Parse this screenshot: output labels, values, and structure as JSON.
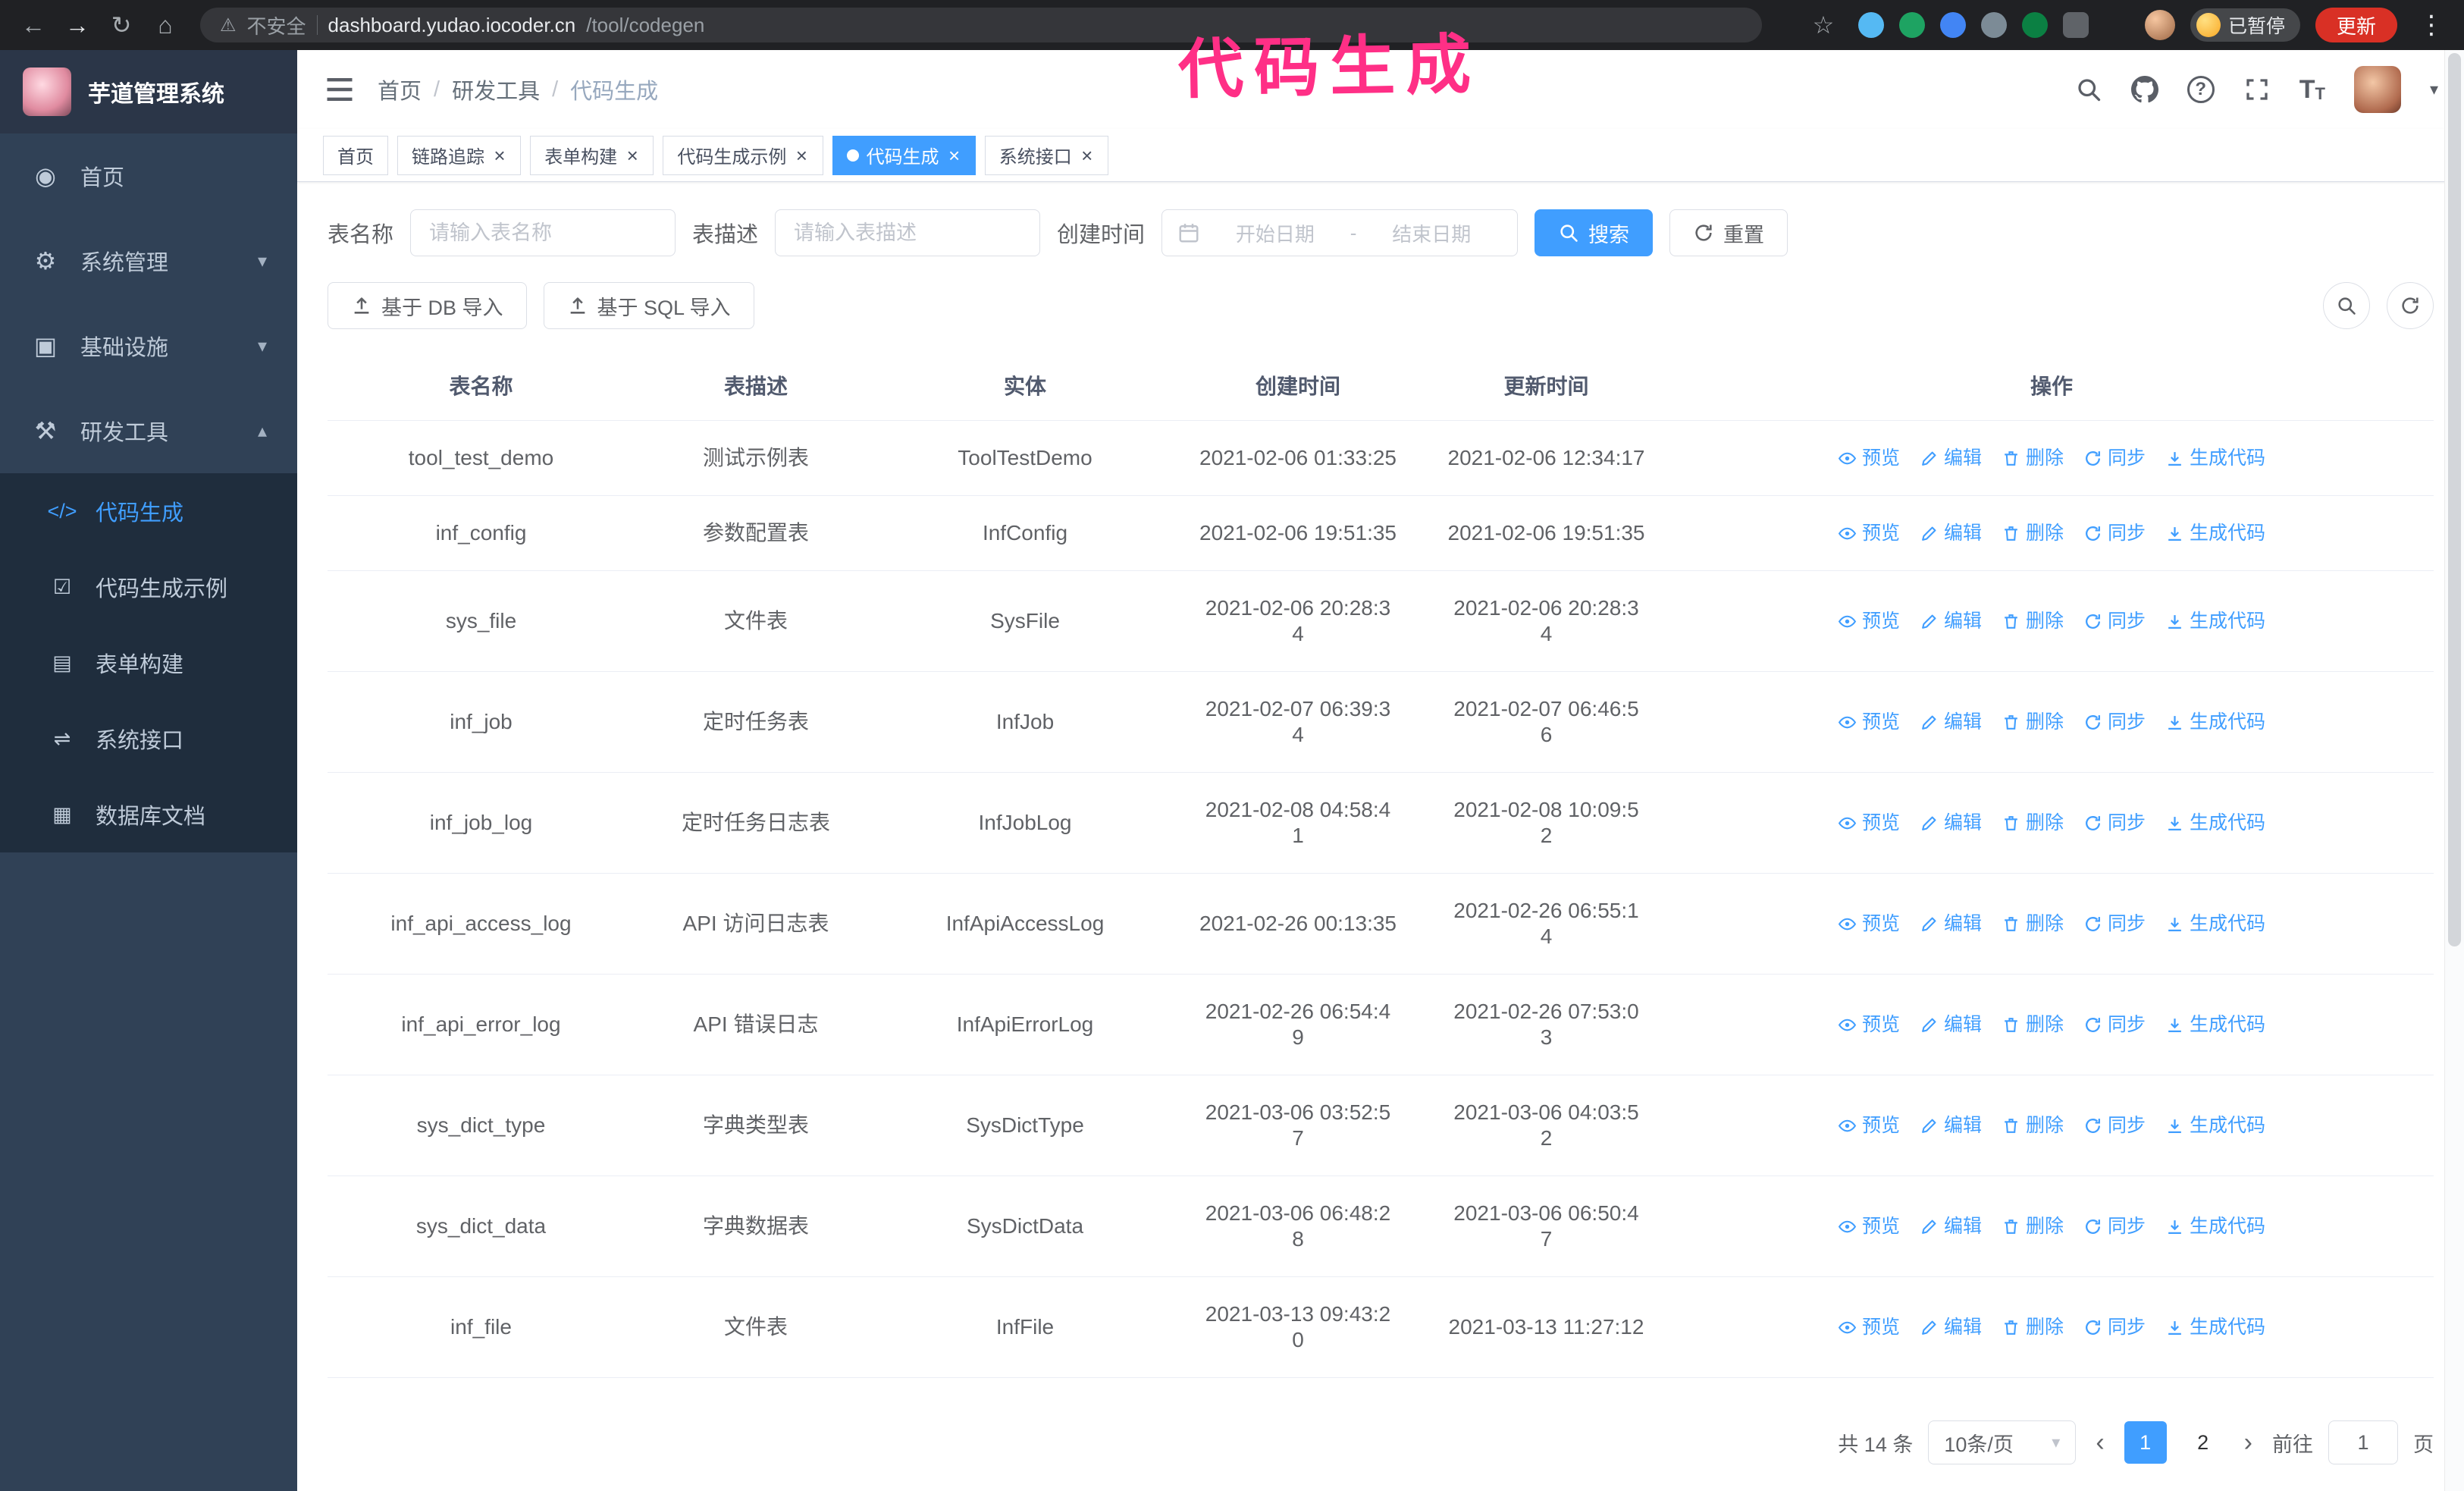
{
  "theme": {
    "primary": "#409EFF",
    "sidebar_bg": "#304156",
    "submenu_bg": "#1f2d3d",
    "annotation": "#ff2f86"
  },
  "icons": {
    "back": "←",
    "forward": "→",
    "reload": "↻",
    "home": "⌂",
    "star": "☆",
    "kebab": "⋮",
    "warning": "⚠",
    "caret_down": "▾",
    "caret_up": "▴",
    "close": "×",
    "prev": "‹",
    "next": "›"
  },
  "browser": {
    "security_label": "不安全",
    "url_host": "dashboard.yudao.iocoder.cn",
    "url_path": "/tool/codegen",
    "paused_badge": "已暂停",
    "update_button": "更新"
  },
  "annotation": {
    "text": "代码生成"
  },
  "sidebar": {
    "logo_title": "芋道管理系统",
    "items": [
      {
        "label": "首页",
        "icon": "◉"
      },
      {
        "label": "系统管理",
        "icon": "⚙",
        "chevron_down": true
      },
      {
        "label": "基础设施",
        "icon": "▣",
        "chevron_down": true
      },
      {
        "label": "研发工具",
        "icon": "⚒",
        "chevron_up": true
      }
    ],
    "submenu": [
      {
        "label": "代码生成",
        "icon": "</>",
        "active": true
      },
      {
        "label": "代码生成示例",
        "icon": "☑"
      },
      {
        "label": "表单构建",
        "icon": "▤"
      },
      {
        "label": "系统接口",
        "icon": "⇌"
      },
      {
        "label": "数据库文档",
        "icon": "▦"
      }
    ]
  },
  "breadcrumb": {
    "items": [
      "首页",
      "研发工具",
      "代码生成"
    ],
    "separator": "/"
  },
  "tabs": [
    {
      "label": "首页",
      "closable": false
    },
    {
      "label": "链路追踪",
      "closable": true
    },
    {
      "label": "表单构建",
      "closable": true
    },
    {
      "label": "代码生成示例",
      "closable": true
    },
    {
      "label": "代码生成",
      "closable": true,
      "active": true
    },
    {
      "label": "系统接口",
      "closable": true
    }
  ],
  "filters": {
    "table_name_label": "表名称",
    "table_name_placeholder": "请输入表名称",
    "table_desc_label": "表描述",
    "table_desc_placeholder": "请输入表描述",
    "create_time_label": "创建时间",
    "date_start_placeholder": "开始日期",
    "date_separator": "-",
    "date_end_placeholder": "结束日期",
    "search_label": "搜索",
    "reset_label": "重置"
  },
  "toolbar": {
    "import_db_label": "基于 DB 导入",
    "import_sql_label": "基于 SQL 导入"
  },
  "table": {
    "columns": [
      "表名称",
      "表描述",
      "实体",
      "创建时间",
      "更新时间",
      "操作"
    ],
    "actions": [
      "预览",
      "编辑",
      "删除",
      "同步",
      "生成代码"
    ],
    "rows": [
      {
        "name": "tool_test_demo",
        "description": "测试示例表",
        "entity": "ToolTestDemo",
        "create_time": "2021-02-06 01:33:25",
        "update_time": "2021-02-06 12:34:17"
      },
      {
        "name": "inf_config",
        "description": "参数配置表",
        "entity": "InfConfig",
        "create_time": "2021-02-06 19:51:35",
        "update_time": "2021-02-06 19:51:35"
      },
      {
        "name": "sys_file",
        "description": "文件表",
        "entity": "SysFile",
        "create_time": "2021-02-06 20:28:3\n4",
        "update_time": "2021-02-06 20:28:3\n4"
      },
      {
        "name": "inf_job",
        "description": "定时任务表",
        "entity": "InfJob",
        "create_time": "2021-02-07 06:39:3\n4",
        "update_time": "2021-02-07 06:46:5\n6"
      },
      {
        "name": "inf_job_log",
        "description": "定时任务日志表",
        "entity": "InfJobLog",
        "create_time": "2021-02-08 04:58:4\n1",
        "update_time": "2021-02-08 10:09:5\n2"
      },
      {
        "name": "inf_api_access_log",
        "description": "API 访问日志表",
        "entity": "InfApiAccessLog",
        "create_time": "2021-02-26 00:13:35",
        "update_time": "2021-02-26 06:55:1\n4"
      },
      {
        "name": "inf_api_error_log",
        "description": "API 错误日志",
        "entity": "InfApiErrorLog",
        "create_time": "2021-02-26 06:54:4\n9",
        "update_time": "2021-02-26 07:53:0\n3"
      },
      {
        "name": "sys_dict_type",
        "description": "字典类型表",
        "entity": "SysDictType",
        "create_time": "2021-03-06 03:52:5\n7",
        "update_time": "2021-03-06 04:03:5\n2"
      },
      {
        "name": "sys_dict_data",
        "description": "字典数据表",
        "entity": "SysDictData",
        "create_time": "2021-03-06 06:48:2\n8",
        "update_time": "2021-03-06 06:50:4\n7"
      },
      {
        "name": "inf_file",
        "description": "文件表",
        "entity": "InfFile",
        "create_time": "2021-03-13 09:43:2\n0",
        "update_time": "2021-03-13 11:27:12"
      }
    ]
  },
  "pagination": {
    "total_label": "共 14 条",
    "page_size_label": "10条/页",
    "pages": [
      {
        "num": "1",
        "active": true
      },
      {
        "num": "2"
      }
    ],
    "goto_label": "前往",
    "goto_value": "1",
    "goto_suffix": "页"
  }
}
